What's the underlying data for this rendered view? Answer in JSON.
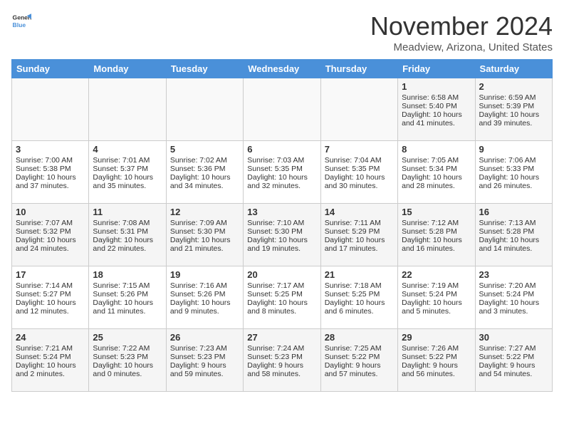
{
  "logo": {
    "line1": "General",
    "line2": "Blue"
  },
  "title": "November 2024",
  "subtitle": "Meadview, Arizona, United States",
  "days_of_week": [
    "Sunday",
    "Monday",
    "Tuesday",
    "Wednesday",
    "Thursday",
    "Friday",
    "Saturday"
  ],
  "weeks": [
    [
      {
        "day": "",
        "text": ""
      },
      {
        "day": "",
        "text": ""
      },
      {
        "day": "",
        "text": ""
      },
      {
        "day": "",
        "text": ""
      },
      {
        "day": "",
        "text": ""
      },
      {
        "day": "1",
        "text": "Sunrise: 6:58 AM\nSunset: 5:40 PM\nDaylight: 10 hours and 41 minutes."
      },
      {
        "day": "2",
        "text": "Sunrise: 6:59 AM\nSunset: 5:39 PM\nDaylight: 10 hours and 39 minutes."
      }
    ],
    [
      {
        "day": "3",
        "text": "Sunrise: 7:00 AM\nSunset: 5:38 PM\nDaylight: 10 hours and 37 minutes."
      },
      {
        "day": "4",
        "text": "Sunrise: 7:01 AM\nSunset: 5:37 PM\nDaylight: 10 hours and 35 minutes."
      },
      {
        "day": "5",
        "text": "Sunrise: 7:02 AM\nSunset: 5:36 PM\nDaylight: 10 hours and 34 minutes."
      },
      {
        "day": "6",
        "text": "Sunrise: 7:03 AM\nSunset: 5:35 PM\nDaylight: 10 hours and 32 minutes."
      },
      {
        "day": "7",
        "text": "Sunrise: 7:04 AM\nSunset: 5:35 PM\nDaylight: 10 hours and 30 minutes."
      },
      {
        "day": "8",
        "text": "Sunrise: 7:05 AM\nSunset: 5:34 PM\nDaylight: 10 hours and 28 minutes."
      },
      {
        "day": "9",
        "text": "Sunrise: 7:06 AM\nSunset: 5:33 PM\nDaylight: 10 hours and 26 minutes."
      }
    ],
    [
      {
        "day": "10",
        "text": "Sunrise: 7:07 AM\nSunset: 5:32 PM\nDaylight: 10 hours and 24 minutes."
      },
      {
        "day": "11",
        "text": "Sunrise: 7:08 AM\nSunset: 5:31 PM\nDaylight: 10 hours and 22 minutes."
      },
      {
        "day": "12",
        "text": "Sunrise: 7:09 AM\nSunset: 5:30 PM\nDaylight: 10 hours and 21 minutes."
      },
      {
        "day": "13",
        "text": "Sunrise: 7:10 AM\nSunset: 5:30 PM\nDaylight: 10 hours and 19 minutes."
      },
      {
        "day": "14",
        "text": "Sunrise: 7:11 AM\nSunset: 5:29 PM\nDaylight: 10 hours and 17 minutes."
      },
      {
        "day": "15",
        "text": "Sunrise: 7:12 AM\nSunset: 5:28 PM\nDaylight: 10 hours and 16 minutes."
      },
      {
        "day": "16",
        "text": "Sunrise: 7:13 AM\nSunset: 5:28 PM\nDaylight: 10 hours and 14 minutes."
      }
    ],
    [
      {
        "day": "17",
        "text": "Sunrise: 7:14 AM\nSunset: 5:27 PM\nDaylight: 10 hours and 12 minutes."
      },
      {
        "day": "18",
        "text": "Sunrise: 7:15 AM\nSunset: 5:26 PM\nDaylight: 10 hours and 11 minutes."
      },
      {
        "day": "19",
        "text": "Sunrise: 7:16 AM\nSunset: 5:26 PM\nDaylight: 10 hours and 9 minutes."
      },
      {
        "day": "20",
        "text": "Sunrise: 7:17 AM\nSunset: 5:25 PM\nDaylight: 10 hours and 8 minutes."
      },
      {
        "day": "21",
        "text": "Sunrise: 7:18 AM\nSunset: 5:25 PM\nDaylight: 10 hours and 6 minutes."
      },
      {
        "day": "22",
        "text": "Sunrise: 7:19 AM\nSunset: 5:24 PM\nDaylight: 10 hours and 5 minutes."
      },
      {
        "day": "23",
        "text": "Sunrise: 7:20 AM\nSunset: 5:24 PM\nDaylight: 10 hours and 3 minutes."
      }
    ],
    [
      {
        "day": "24",
        "text": "Sunrise: 7:21 AM\nSunset: 5:24 PM\nDaylight: 10 hours and 2 minutes."
      },
      {
        "day": "25",
        "text": "Sunrise: 7:22 AM\nSunset: 5:23 PM\nDaylight: 10 hours and 0 minutes."
      },
      {
        "day": "26",
        "text": "Sunrise: 7:23 AM\nSunset: 5:23 PM\nDaylight: 9 hours and 59 minutes."
      },
      {
        "day": "27",
        "text": "Sunrise: 7:24 AM\nSunset: 5:23 PM\nDaylight: 9 hours and 58 minutes."
      },
      {
        "day": "28",
        "text": "Sunrise: 7:25 AM\nSunset: 5:22 PM\nDaylight: 9 hours and 57 minutes."
      },
      {
        "day": "29",
        "text": "Sunrise: 7:26 AM\nSunset: 5:22 PM\nDaylight: 9 hours and 56 minutes."
      },
      {
        "day": "30",
        "text": "Sunrise: 7:27 AM\nSunset: 5:22 PM\nDaylight: 9 hours and 54 minutes."
      }
    ]
  ]
}
